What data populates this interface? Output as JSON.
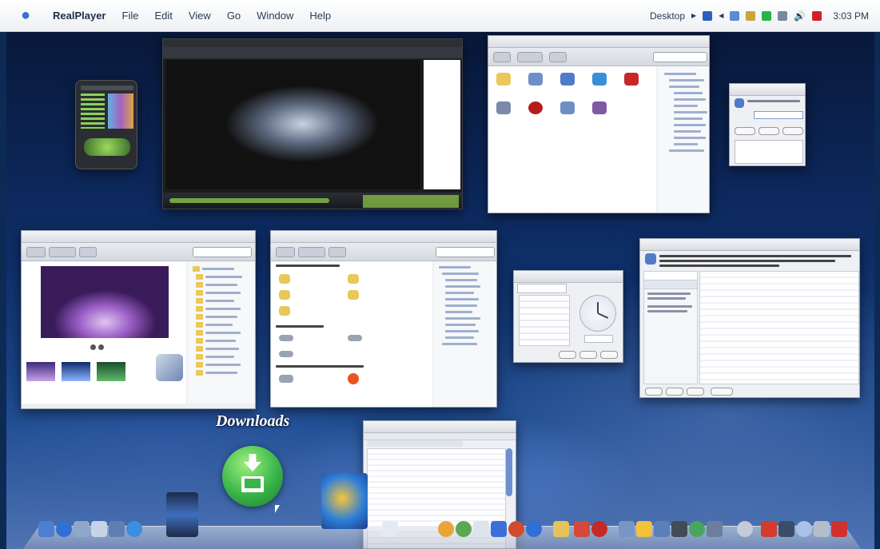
{
  "menubar": {
    "app_name": "RealPlayer",
    "menus": [
      "File",
      "Edit",
      "View",
      "Go",
      "Window",
      "Help"
    ],
    "desktop_label": "Desktop",
    "clock": "3:03 PM",
    "icons": [
      "apple-icon",
      "language-icon",
      "monitor-icon",
      "network-icon",
      "battery-icon",
      "chart-icon",
      "volume-icon",
      "antivirus-icon"
    ]
  },
  "dock": {
    "downloads_label": "Downloads",
    "icons": [
      "finder-icon",
      "help-icon",
      "iphoto-icon",
      "mail-icon",
      "chess-icon",
      "network-icon",
      "film-icon",
      "downloads-icon",
      "windows-icon",
      "folder-icon",
      "ie-icon",
      "record-icon",
      "camera-icon",
      "trash-icon",
      "power-icon"
    ]
  },
  "colors": {
    "desktop_top": "#08183a",
    "desktop_bottom": "#4f74b3",
    "downloads_green": "#39b54a",
    "player_accent": "#8bc34a"
  }
}
